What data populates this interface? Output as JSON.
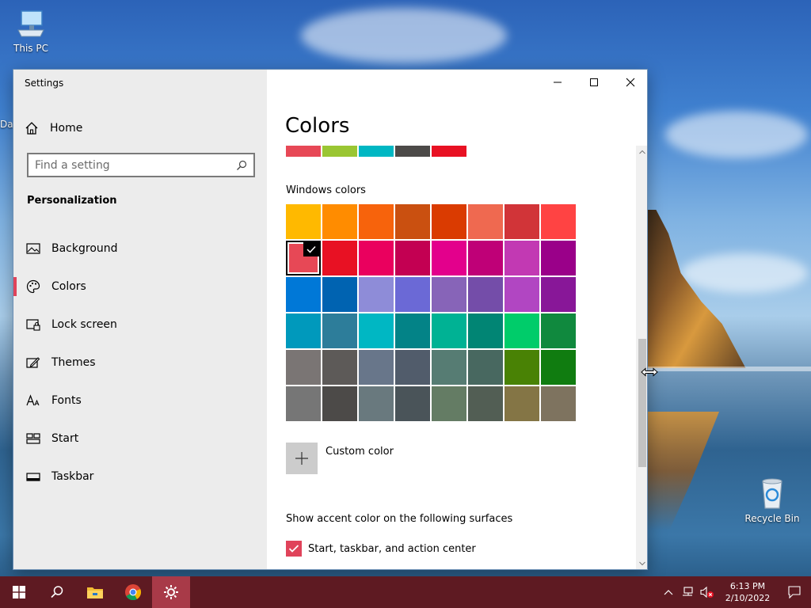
{
  "desktop": {
    "icons": [
      {
        "label": "This PC"
      },
      {
        "label": "Recycle Bin"
      },
      {
        "label": "Da"
      }
    ]
  },
  "window": {
    "title": "Settings",
    "controls": {
      "minimize": "minimize-icon",
      "maximize": "maximize-icon",
      "close": "close-icon"
    }
  },
  "sidebar": {
    "home_label": "Home",
    "search_placeholder": "Find a setting",
    "section_title": "Personalization",
    "items": [
      {
        "label": "Background",
        "icon": "picture-icon",
        "active": false
      },
      {
        "label": "Colors",
        "icon": "palette-icon",
        "active": true
      },
      {
        "label": "Lock screen",
        "icon": "lock-screen-icon",
        "active": false
      },
      {
        "label": "Themes",
        "icon": "themes-icon",
        "active": false
      },
      {
        "label": "Fonts",
        "icon": "fonts-icon",
        "active": false
      },
      {
        "label": "Start",
        "icon": "start-icon",
        "active": false
      },
      {
        "label": "Taskbar",
        "icon": "taskbar-icon",
        "active": false
      }
    ]
  },
  "main": {
    "title": "Colors",
    "recent_colors": [
      "#e74856",
      "#9ac633",
      "#00b7c3",
      "#4c4a48",
      "#e81123"
    ],
    "windows_colors_label": "Windows colors",
    "swatches": [
      [
        "#ffb900",
        "#ff8c00",
        "#f7630c",
        "#ca5010",
        "#da3b01",
        "#ef6950",
        "#d13438",
        "#ff4343"
      ],
      [
        "#e74856",
        "#e81123",
        "#ea005e",
        "#c30052",
        "#e3008c",
        "#bf0077",
        "#c239b3",
        "#9a0089"
      ],
      [
        "#0078d7",
        "#0063b1",
        "#8e8cd8",
        "#6b69d6",
        "#8764b8",
        "#744da9",
        "#b146c2",
        "#881798"
      ],
      [
        "#0099bc",
        "#2d7d9a",
        "#00b7c3",
        "#038387",
        "#00b294",
        "#018574",
        "#00cc6a",
        "#10893e"
      ],
      [
        "#7a7574",
        "#5d5a58",
        "#68768a",
        "#515c6b",
        "#567c73",
        "#486860",
        "#498205",
        "#107c10"
      ],
      [
        "#767676",
        "#4c4a48",
        "#69797e",
        "#4a5459",
        "#647c64",
        "#525e54",
        "#847545",
        "#7e735f"
      ]
    ],
    "selected_swatch": {
      "row": 1,
      "col": 0
    },
    "custom_color_label": "Custom color",
    "surfaces_heading": "Show accent color on the following surfaces",
    "surfaces_checkbox_label": "Start, taskbar, and action center",
    "surfaces_checked": true,
    "accent_color": "#e0435a"
  },
  "taskbar": {
    "time": "6:13 PM",
    "date": "2/10/2022",
    "color": "#5e1a22"
  }
}
